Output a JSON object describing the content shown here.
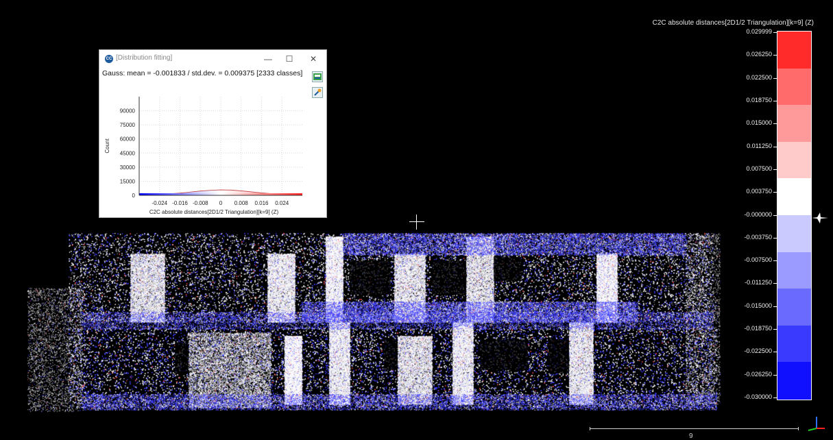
{
  "viewport": {
    "scale_title": "C2C absolute distances[2D1/2 Triangulation][k=9] (Z)",
    "scale_labels": [
      "0.029999",
      "0.026250",
      "0.022500",
      "0.018750",
      "0.015000",
      "0.011250",
      "0.007500",
      "0.003750",
      "-0.000000",
      "-0.003750",
      "-0.007500",
      "-0.011250",
      "-0.015000",
      "-0.018750",
      "-0.022500",
      "-0.026250",
      "-0.030000"
    ],
    "scale_bands": [
      "#ff2a2a",
      "#ff6a6a",
      "#ff9a9a",
      "#ffcaca",
      "#ffffff",
      "#cacaff",
      "#9a9aff",
      "#6a6aff",
      "#3a3aff",
      "#1010ff"
    ],
    "scale_bar_value": "9",
    "axis_colors": {
      "x": "#ff2020",
      "y": "#20d020",
      "z": "#3070ff"
    }
  },
  "dialog": {
    "title": "[Distribution fitting]",
    "app_icon": "CC",
    "minimize": "—",
    "maximize": "☐",
    "close": "✕",
    "summary": "Gauss: mean = -0.001833 / std.dev. = 0.009375 [2333 classes]",
    "export_icon": "export-icon",
    "settings_icon": "settings-icon"
  },
  "chart_data": {
    "type": "area",
    "ylabel": "Count",
    "xlabel": "C2C absolute distances[2D1/2 Triangulation][k=9] (Z)",
    "xlim": [
      -0.032,
      0.032
    ],
    "ylim": [
      0,
      105000
    ],
    "yticks": [
      0,
      15000,
      30000,
      45000,
      60000,
      75000,
      90000
    ],
    "xticks": [
      -0.024,
      -0.016,
      -0.008,
      0,
      0.008,
      0.016,
      0.024
    ],
    "xtick_labels": [
      "-0.024",
      "-0.016",
      "-0.008",
      "0",
      "0.008",
      "0.016",
      "0.024"
    ],
    "grid": true,
    "series": [
      {
        "x": [
          -0.032,
          -0.024,
          -0.016,
          -0.008,
          -0.004,
          0,
          0.004,
          0.008,
          0.016,
          0.024,
          0.032
        ],
        "values": [
          300,
          900,
          2400,
          4600,
          5400,
          5800,
          5600,
          4800,
          2600,
          1000,
          300
        ]
      }
    ]
  }
}
